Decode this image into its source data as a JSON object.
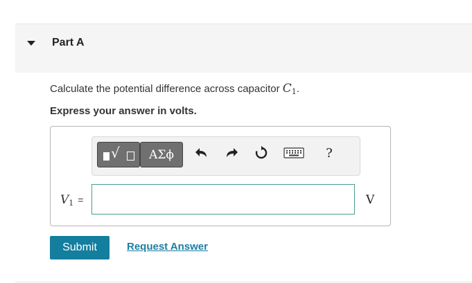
{
  "part": {
    "title": "Part A"
  },
  "question": {
    "prefix": "Calculate the potential difference across capacitor ",
    "var": "C",
    "sub": "1",
    "suffix": ".",
    "instruction": "Express your answer in volts."
  },
  "toolbar": {
    "templates_icons": [
      "square-icon",
      "radical-icon",
      "square-icon"
    ],
    "symbols_label": "ΑΣϕ",
    "undo_icon": "undo-arrow-icon",
    "redo_icon": "redo-arrow-icon",
    "reset_icon": "reset-icon",
    "keyboard_icon": "keyboard-icon",
    "help_label": "?"
  },
  "answer": {
    "var": "V",
    "sub": "1",
    "equals": "=",
    "value": "",
    "unit": "V"
  },
  "actions": {
    "submit_label": "Submit",
    "request_label": "Request Answer"
  },
  "colors": {
    "submit_bg": "#137e9e",
    "link": "#1b7ea3",
    "input_border": "#4a9c8c"
  }
}
